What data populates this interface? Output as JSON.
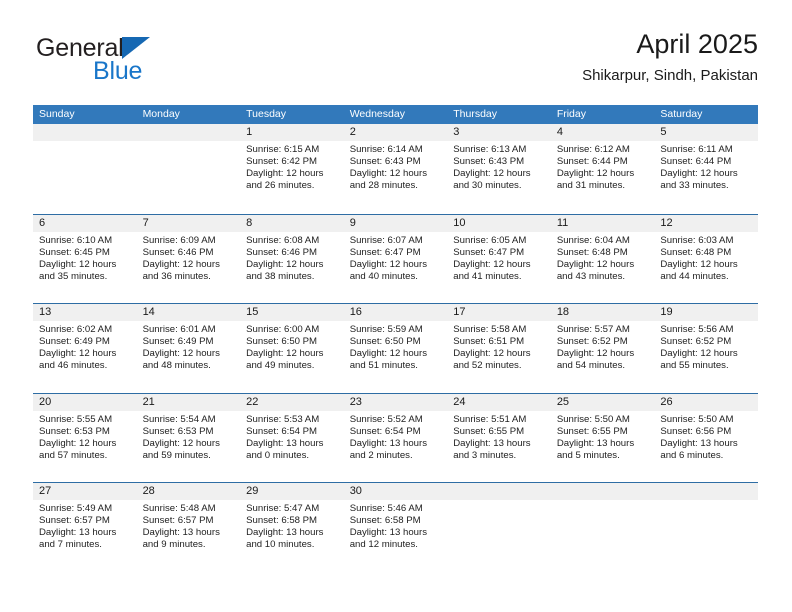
{
  "brand": {
    "name_part1": "General",
    "name_part2": "Blue",
    "accent_color": "#1976c9",
    "triangle_color": "#1668b3"
  },
  "header": {
    "title": "April 2025",
    "location": "Shikarpur, Sindh, Pakistan"
  },
  "theme": {
    "header_row_color": "#3279bb",
    "week_divider_color": "#2e6da4",
    "day_band_color": "#f0f0f0",
    "text_color": "#1a1a1a"
  },
  "weekdays": [
    "Sunday",
    "Monday",
    "Tuesday",
    "Wednesday",
    "Thursday",
    "Friday",
    "Saturday"
  ],
  "weeks": [
    [
      {
        "day": "",
        "blank": true
      },
      {
        "day": "",
        "blank": true
      },
      {
        "day": "1",
        "sunrise": "Sunrise: 6:15 AM",
        "sunset": "Sunset: 6:42 PM",
        "daylight_line1": "Daylight: 12 hours",
        "daylight_line2": "and 26 minutes."
      },
      {
        "day": "2",
        "sunrise": "Sunrise: 6:14 AM",
        "sunset": "Sunset: 6:43 PM",
        "daylight_line1": "Daylight: 12 hours",
        "daylight_line2": "and 28 minutes."
      },
      {
        "day": "3",
        "sunrise": "Sunrise: 6:13 AM",
        "sunset": "Sunset: 6:43 PM",
        "daylight_line1": "Daylight: 12 hours",
        "daylight_line2": "and 30 minutes."
      },
      {
        "day": "4",
        "sunrise": "Sunrise: 6:12 AM",
        "sunset": "Sunset: 6:44 PM",
        "daylight_line1": "Daylight: 12 hours",
        "daylight_line2": "and 31 minutes."
      },
      {
        "day": "5",
        "sunrise": "Sunrise: 6:11 AM",
        "sunset": "Sunset: 6:44 PM",
        "daylight_line1": "Daylight: 12 hours",
        "daylight_line2": "and 33 minutes."
      }
    ],
    [
      {
        "day": "6",
        "sunrise": "Sunrise: 6:10 AM",
        "sunset": "Sunset: 6:45 PM",
        "daylight_line1": "Daylight: 12 hours",
        "daylight_line2": "and 35 minutes."
      },
      {
        "day": "7",
        "sunrise": "Sunrise: 6:09 AM",
        "sunset": "Sunset: 6:46 PM",
        "daylight_line1": "Daylight: 12 hours",
        "daylight_line2": "and 36 minutes."
      },
      {
        "day": "8",
        "sunrise": "Sunrise: 6:08 AM",
        "sunset": "Sunset: 6:46 PM",
        "daylight_line1": "Daylight: 12 hours",
        "daylight_line2": "and 38 minutes."
      },
      {
        "day": "9",
        "sunrise": "Sunrise: 6:07 AM",
        "sunset": "Sunset: 6:47 PM",
        "daylight_line1": "Daylight: 12 hours",
        "daylight_line2": "and 40 minutes."
      },
      {
        "day": "10",
        "sunrise": "Sunrise: 6:05 AM",
        "sunset": "Sunset: 6:47 PM",
        "daylight_line1": "Daylight: 12 hours",
        "daylight_line2": "and 41 minutes."
      },
      {
        "day": "11",
        "sunrise": "Sunrise: 6:04 AM",
        "sunset": "Sunset: 6:48 PM",
        "daylight_line1": "Daylight: 12 hours",
        "daylight_line2": "and 43 minutes."
      },
      {
        "day": "12",
        "sunrise": "Sunrise: 6:03 AM",
        "sunset": "Sunset: 6:48 PM",
        "daylight_line1": "Daylight: 12 hours",
        "daylight_line2": "and 44 minutes."
      }
    ],
    [
      {
        "day": "13",
        "sunrise": "Sunrise: 6:02 AM",
        "sunset": "Sunset: 6:49 PM",
        "daylight_line1": "Daylight: 12 hours",
        "daylight_line2": "and 46 minutes."
      },
      {
        "day": "14",
        "sunrise": "Sunrise: 6:01 AM",
        "sunset": "Sunset: 6:49 PM",
        "daylight_line1": "Daylight: 12 hours",
        "daylight_line2": "and 48 minutes."
      },
      {
        "day": "15",
        "sunrise": "Sunrise: 6:00 AM",
        "sunset": "Sunset: 6:50 PM",
        "daylight_line1": "Daylight: 12 hours",
        "daylight_line2": "and 49 minutes."
      },
      {
        "day": "16",
        "sunrise": "Sunrise: 5:59 AM",
        "sunset": "Sunset: 6:50 PM",
        "daylight_line1": "Daylight: 12 hours",
        "daylight_line2": "and 51 minutes."
      },
      {
        "day": "17",
        "sunrise": "Sunrise: 5:58 AM",
        "sunset": "Sunset: 6:51 PM",
        "daylight_line1": "Daylight: 12 hours",
        "daylight_line2": "and 52 minutes."
      },
      {
        "day": "18",
        "sunrise": "Sunrise: 5:57 AM",
        "sunset": "Sunset: 6:52 PM",
        "daylight_line1": "Daylight: 12 hours",
        "daylight_line2": "and 54 minutes."
      },
      {
        "day": "19",
        "sunrise": "Sunrise: 5:56 AM",
        "sunset": "Sunset: 6:52 PM",
        "daylight_line1": "Daylight: 12 hours",
        "daylight_line2": "and 55 minutes."
      }
    ],
    [
      {
        "day": "20",
        "sunrise": "Sunrise: 5:55 AM",
        "sunset": "Sunset: 6:53 PM",
        "daylight_line1": "Daylight: 12 hours",
        "daylight_line2": "and 57 minutes."
      },
      {
        "day": "21",
        "sunrise": "Sunrise: 5:54 AM",
        "sunset": "Sunset: 6:53 PM",
        "daylight_line1": "Daylight: 12 hours",
        "daylight_line2": "and 59 minutes."
      },
      {
        "day": "22",
        "sunrise": "Sunrise: 5:53 AM",
        "sunset": "Sunset: 6:54 PM",
        "daylight_line1": "Daylight: 13 hours",
        "daylight_line2": "and 0 minutes."
      },
      {
        "day": "23",
        "sunrise": "Sunrise: 5:52 AM",
        "sunset": "Sunset: 6:54 PM",
        "daylight_line1": "Daylight: 13 hours",
        "daylight_line2": "and 2 minutes."
      },
      {
        "day": "24",
        "sunrise": "Sunrise: 5:51 AM",
        "sunset": "Sunset: 6:55 PM",
        "daylight_line1": "Daylight: 13 hours",
        "daylight_line2": "and 3 minutes."
      },
      {
        "day": "25",
        "sunrise": "Sunrise: 5:50 AM",
        "sunset": "Sunset: 6:55 PM",
        "daylight_line1": "Daylight: 13 hours",
        "daylight_line2": "and 5 minutes."
      },
      {
        "day": "26",
        "sunrise": "Sunrise: 5:50 AM",
        "sunset": "Sunset: 6:56 PM",
        "daylight_line1": "Daylight: 13 hours",
        "daylight_line2": "and 6 minutes."
      }
    ],
    [
      {
        "day": "27",
        "sunrise": "Sunrise: 5:49 AM",
        "sunset": "Sunset: 6:57 PM",
        "daylight_line1": "Daylight: 13 hours",
        "daylight_line2": "and 7 minutes."
      },
      {
        "day": "28",
        "sunrise": "Sunrise: 5:48 AM",
        "sunset": "Sunset: 6:57 PM",
        "daylight_line1": "Daylight: 13 hours",
        "daylight_line2": "and 9 minutes."
      },
      {
        "day": "29",
        "sunrise": "Sunrise: 5:47 AM",
        "sunset": "Sunset: 6:58 PM",
        "daylight_line1": "Daylight: 13 hours",
        "daylight_line2": "and 10 minutes."
      },
      {
        "day": "30",
        "sunrise": "Sunrise: 5:46 AM",
        "sunset": "Sunset: 6:58 PM",
        "daylight_line1": "Daylight: 13 hours",
        "daylight_line2": "and 12 minutes."
      },
      {
        "day": "",
        "blank": true
      },
      {
        "day": "",
        "blank": true
      },
      {
        "day": "",
        "blank": true
      }
    ]
  ]
}
